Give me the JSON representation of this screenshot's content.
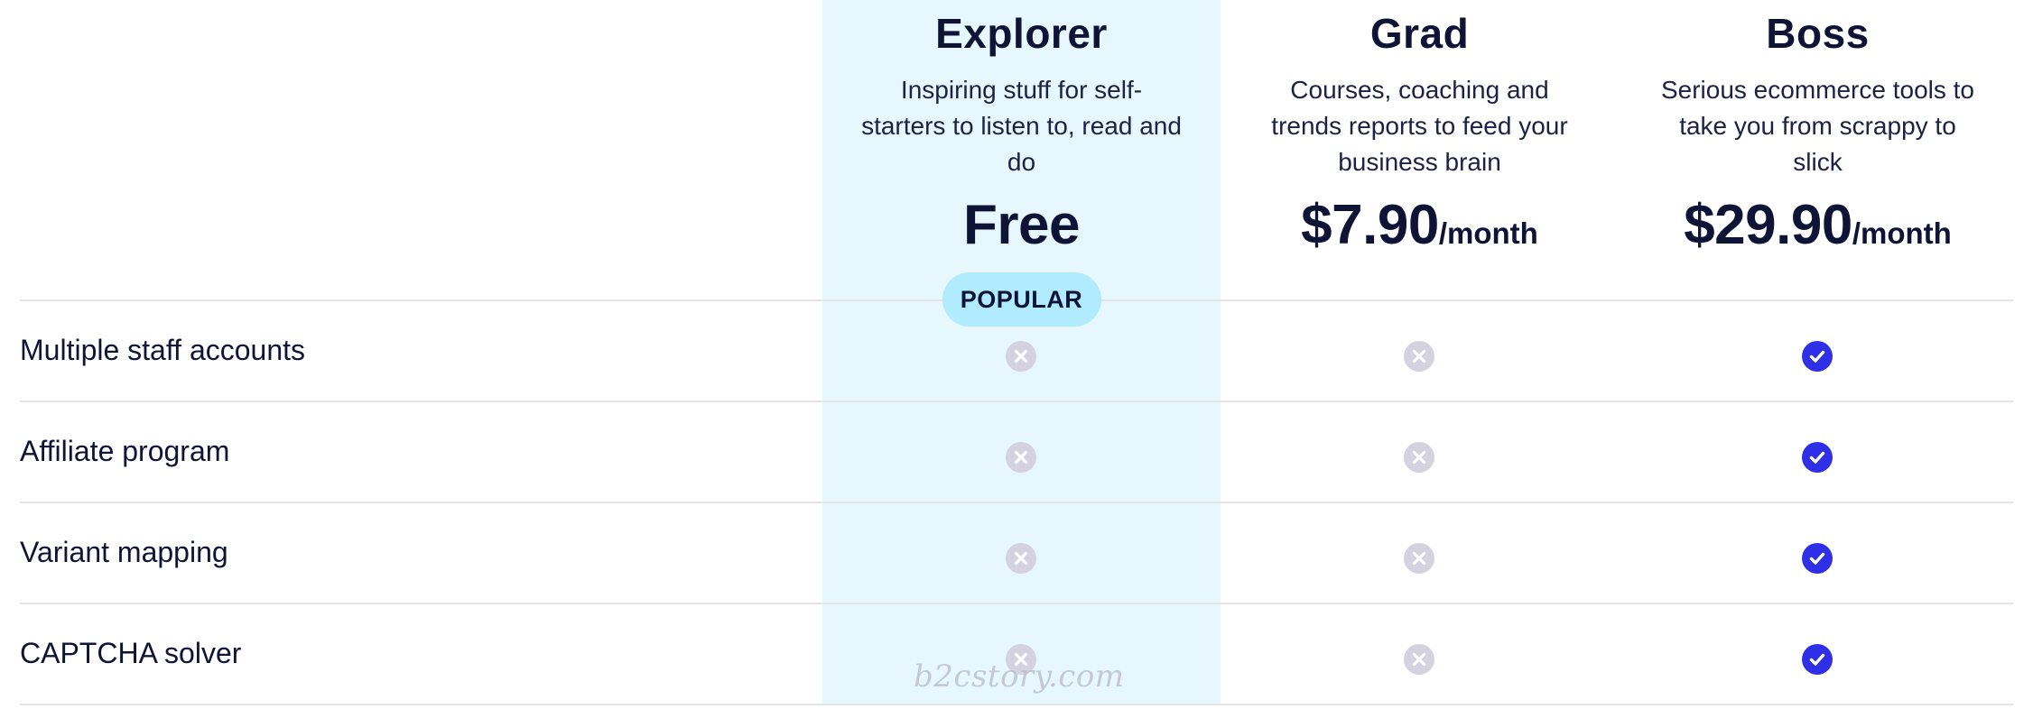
{
  "plans": [
    {
      "name": "Explorer",
      "description": "Inspiring stuff for self-starters to listen to, read and do",
      "price": "Free",
      "period": "",
      "badge": "POPULAR",
      "highlight_color": "#e6f7fd"
    },
    {
      "name": "Grad",
      "description": "Courses, coaching and trends reports to feed your business brain",
      "price": "$7.90",
      "period": "/month",
      "badge": ""
    },
    {
      "name": "Boss",
      "description": "Serious ecommerce tools to take you from scrappy to slick",
      "price": "$29.90",
      "period": "/month",
      "badge": ""
    }
  ],
  "features": [
    {
      "label": "Multiple staff accounts",
      "included": [
        false,
        false,
        true
      ]
    },
    {
      "label": "Affiliate program",
      "included": [
        false,
        false,
        true
      ]
    },
    {
      "label": "Variant mapping",
      "included": [
        false,
        false,
        true
      ]
    },
    {
      "label": "CAPTCHA solver",
      "included": [
        false,
        false,
        true
      ]
    }
  ],
  "icons": {
    "included": "check-circle-icon",
    "excluded": "x-circle-icon"
  },
  "colors": {
    "included": "#2f2fe8",
    "excluded": "#d4d2de",
    "badge": "#b0ecfe",
    "text": "#0f1437"
  },
  "watermark": "b2cstory.com"
}
